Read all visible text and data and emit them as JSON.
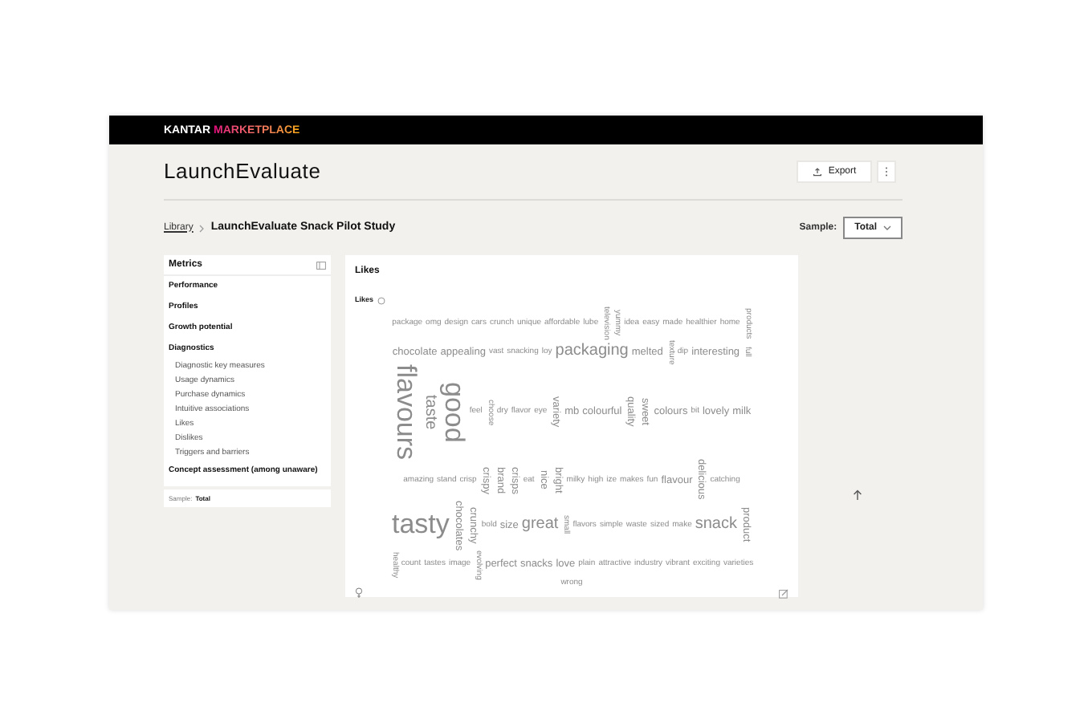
{
  "logo": {
    "brand": "KANTAR",
    "product": "MARKETPLACE"
  },
  "title": "LaunchEvaluate",
  "actions": {
    "export": "Export"
  },
  "breadcrumb": {
    "parent": "Library",
    "current": "LaunchEvaluate Snack Pilot Study"
  },
  "sample_select": {
    "label": "Sample:",
    "value": "Total"
  },
  "metrics": {
    "title": "Metrics",
    "sections": [
      {
        "label": "Performance"
      },
      {
        "label": "Profiles"
      },
      {
        "label": "Growth potential"
      },
      {
        "label": "Diagnostics",
        "children": [
          {
            "label": "Diagnostic key measures"
          },
          {
            "label": "Usage dynamics"
          },
          {
            "label": "Purchase dynamics"
          },
          {
            "label": "Intuitive associations"
          },
          {
            "label": "Likes"
          },
          {
            "label": "Dislikes"
          },
          {
            "label": "Triggers and barriers"
          }
        ]
      },
      {
        "label": "Concept assessment (among unaware)"
      }
    ],
    "sample": {
      "label": "Sample:",
      "value": "Total"
    }
  },
  "chart": {
    "title": "Likes",
    "subtitle": "Likes",
    "words": [
      {
        "text": "package",
        "kind": "small",
        "vertical": false
      },
      {
        "text": "omg",
        "kind": "small",
        "vertical": false
      },
      {
        "text": "design",
        "kind": "small",
        "vertical": false
      },
      {
        "text": "cars",
        "kind": "small",
        "vertical": false
      },
      {
        "text": "crunch",
        "kind": "small",
        "vertical": false
      },
      {
        "text": "unique",
        "kind": "small",
        "vertical": false
      },
      {
        "text": "affordable",
        "kind": "small",
        "vertical": false
      },
      {
        "text": "lube",
        "kind": "small",
        "vertical": false
      },
      {
        "text": "television",
        "kind": "small",
        "vertical": true
      },
      {
        "text": "yummy",
        "kind": "small",
        "vertical": true
      },
      {
        "text": "idea",
        "kind": "small",
        "vertical": false
      },
      {
        "text": "easy",
        "kind": "small",
        "vertical": false
      },
      {
        "text": "made",
        "kind": "small",
        "vertical": false
      },
      {
        "text": "healthier",
        "kind": "small",
        "vertical": false
      },
      {
        "text": "home",
        "kind": "small",
        "vertical": false
      },
      {
        "text": "products",
        "kind": "small",
        "vertical": true
      },
      {
        "text": "chocolate",
        "kind": "medium",
        "vertical": false
      },
      {
        "text": "appealing",
        "kind": "medium",
        "vertical": false
      },
      {
        "text": "vast",
        "kind": "small",
        "vertical": false
      },
      {
        "text": "snacking",
        "kind": "small",
        "vertical": false
      },
      {
        "text": "loy",
        "kind": "small",
        "vertical": false
      },
      {
        "text": "packaging",
        "kind": "large",
        "vertical": false
      },
      {
        "text": "melted",
        "kind": "medium",
        "vertical": false
      },
      {
        "text": "texture",
        "kind": "small",
        "vertical": true
      },
      {
        "text": "dip",
        "kind": "small",
        "vertical": false
      },
      {
        "text": "interesting",
        "kind": "medium",
        "vertical": false
      },
      {
        "text": "full",
        "kind": "small",
        "vertical": true
      },
      {
        "text": "flavours",
        "kind": "huge",
        "vertical": true
      },
      {
        "text": "taste",
        "kind": "large",
        "vertical": true
      },
      {
        "text": "good",
        "kind": "huge",
        "vertical": true
      },
      {
        "text": "feel",
        "kind": "small",
        "vertical": false
      },
      {
        "text": "choose",
        "kind": "small",
        "vertical": true
      },
      {
        "text": "dry",
        "kind": "small",
        "vertical": false
      },
      {
        "text": "flavor",
        "kind": "small",
        "vertical": false
      },
      {
        "text": "eye",
        "kind": "small",
        "vertical": false
      },
      {
        "text": "variety",
        "kind": "medium",
        "vertical": true
      },
      {
        "text": "mb",
        "kind": "medium",
        "vertical": false
      },
      {
        "text": "colourful",
        "kind": "medium",
        "vertical": false
      },
      {
        "text": "quality",
        "kind": "medium",
        "vertical": true
      },
      {
        "text": "sweet",
        "kind": "medium",
        "vertical": true
      },
      {
        "text": "colours",
        "kind": "medium",
        "vertical": false
      },
      {
        "text": "bit",
        "kind": "small",
        "vertical": false
      },
      {
        "text": "lovely",
        "kind": "medium",
        "vertical": false
      },
      {
        "text": "milk",
        "kind": "medium",
        "vertical": false
      },
      {
        "text": "amazing",
        "kind": "small",
        "vertical": false
      },
      {
        "text": "stand",
        "kind": "small",
        "vertical": false
      },
      {
        "text": "crisp",
        "kind": "small",
        "vertical": false
      },
      {
        "text": "crispy",
        "kind": "medium",
        "vertical": true
      },
      {
        "text": "brand",
        "kind": "medium",
        "vertical": true
      },
      {
        "text": "crisps",
        "kind": "medium",
        "vertical": true
      },
      {
        "text": "eat",
        "kind": "small",
        "vertical": false
      },
      {
        "text": "nice",
        "kind": "medium",
        "vertical": true
      },
      {
        "text": "bright",
        "kind": "medium",
        "vertical": true
      },
      {
        "text": "milky",
        "kind": "small",
        "vertical": false
      },
      {
        "text": "high",
        "kind": "small",
        "vertical": false
      },
      {
        "text": "ize",
        "kind": "small",
        "vertical": false
      },
      {
        "text": "makes",
        "kind": "small",
        "vertical": false
      },
      {
        "text": "fun",
        "kind": "small",
        "vertical": false
      },
      {
        "text": "flavour",
        "kind": "medium",
        "vertical": false
      },
      {
        "text": "delicious",
        "kind": "medium",
        "vertical": true
      },
      {
        "text": "catching",
        "kind": "small",
        "vertical": false
      },
      {
        "text": "tasty",
        "kind": "huge",
        "vertical": false
      },
      {
        "text": "chocolates",
        "kind": "medium",
        "vertical": true
      },
      {
        "text": "crunchy",
        "kind": "medium",
        "vertical": true
      },
      {
        "text": "bold",
        "kind": "small",
        "vertical": false
      },
      {
        "text": "size",
        "kind": "medium",
        "vertical": false
      },
      {
        "text": "great",
        "kind": "large",
        "vertical": false
      },
      {
        "text": "small",
        "kind": "small",
        "vertical": true
      },
      {
        "text": "flavors",
        "kind": "small",
        "vertical": false
      },
      {
        "text": "simple",
        "kind": "small",
        "vertical": false
      },
      {
        "text": "waste",
        "kind": "small",
        "vertical": false
      },
      {
        "text": "sized",
        "kind": "small",
        "vertical": false
      },
      {
        "text": "make",
        "kind": "small",
        "vertical": false
      },
      {
        "text": "snack",
        "kind": "large",
        "vertical": false
      },
      {
        "text": "product",
        "kind": "medium",
        "vertical": true
      },
      {
        "text": "healthy",
        "kind": "small",
        "vertical": true
      },
      {
        "text": "count",
        "kind": "small",
        "vertical": false
      },
      {
        "text": "tastes",
        "kind": "small",
        "vertical": false
      },
      {
        "text": "image",
        "kind": "small",
        "vertical": false
      },
      {
        "text": "evolving",
        "kind": "small",
        "vertical": true
      },
      {
        "text": "perfect",
        "kind": "medium",
        "vertical": false
      },
      {
        "text": "snacks",
        "kind": "medium",
        "vertical": false
      },
      {
        "text": "love",
        "kind": "medium",
        "vertical": false
      },
      {
        "text": "plain",
        "kind": "small",
        "vertical": false
      },
      {
        "text": "attractive",
        "kind": "small",
        "vertical": false
      },
      {
        "text": "industry",
        "kind": "small",
        "vertical": false
      },
      {
        "text": "vibrant",
        "kind": "small",
        "vertical": false
      },
      {
        "text": "exciting",
        "kind": "small",
        "vertical": false
      },
      {
        "text": "varieties",
        "kind": "small",
        "vertical": false
      },
      {
        "text": "wrong",
        "kind": "small",
        "vertical": false
      }
    ]
  }
}
